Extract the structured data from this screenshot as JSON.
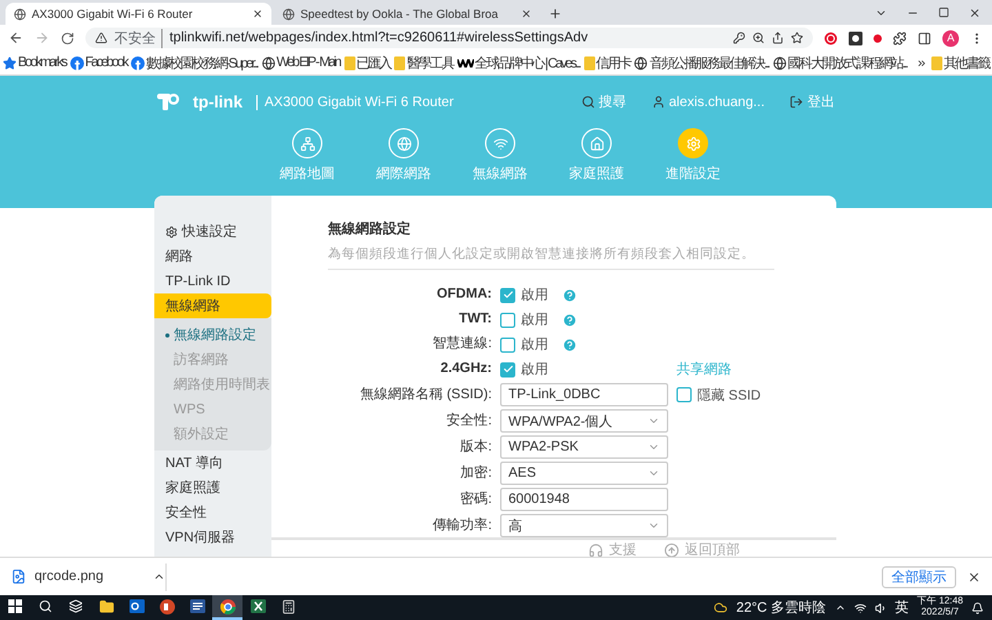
{
  "browser": {
    "tabs": [
      {
        "title": "AX3000 Gigabit Wi-Fi 6 Router",
        "selected": true
      },
      {
        "title": "Speedtest by Ookla - The Global Broa",
        "selected": false
      }
    ],
    "address": {
      "security": "不安全",
      "url": "tplinkwifi.net/webpages/index.html?t=c9260611#wirelessSettingsAdv"
    },
    "profile": "A",
    "bookmarks": [
      {
        "label": "Bookmarks",
        "kind": "star"
      },
      {
        "label": "Facebook",
        "kind": "facebook"
      },
      {
        "label": "數據校園校務網-Super...",
        "kind": "facebook"
      },
      {
        "label": "Web EIP - Main",
        "kind": "globe"
      },
      {
        "label": "已匯入",
        "kind": "folder"
      },
      {
        "label": "醫學工具",
        "kind": "folder"
      },
      {
        "label": "全球品牌中心 | Caves...",
        "kind": "wix"
      },
      {
        "label": "信用卡",
        "kind": "folder"
      },
      {
        "label": "音頻公播服務最佳解決...",
        "kind": "globe"
      },
      {
        "label": "國科大開放式課程網站...",
        "kind": "globe"
      }
    ],
    "other_bookmarks": "其他書籤"
  },
  "header": {
    "brand": "tp-link",
    "model": "AX3000 Gigabit Wi-Fi 6 Router",
    "search": "搜尋",
    "user": "alexis.chuang...",
    "logout": "登出"
  },
  "nav": [
    {
      "label": "網路地圖",
      "selected": false
    },
    {
      "label": "網際網路",
      "selected": false
    },
    {
      "label": "無線網路",
      "selected": false
    },
    {
      "label": "家庭照護",
      "selected": false
    },
    {
      "label": "進階設定",
      "selected": true
    }
  ],
  "sidebar": [
    {
      "label": "快速設定",
      "kind": "quick",
      "selected": false
    },
    {
      "label": "網路",
      "selected": false
    },
    {
      "label": "TP-Link ID",
      "selected": false
    },
    {
      "label": "無線網路",
      "selected": true,
      "children": [
        {
          "label": "無線網路設定",
          "selected": true
        },
        {
          "label": "訪客網路",
          "selected": false
        },
        {
          "label": "網路使用時間表",
          "selected": false
        },
        {
          "label": "WPS",
          "selected": false
        },
        {
          "label": "額外設定",
          "selected": false
        }
      ]
    },
    {
      "label": "NAT 導向",
      "selected": false
    },
    {
      "label": "家庭照護",
      "selected": false
    },
    {
      "label": "安全性",
      "selected": false
    },
    {
      "label": "VPN伺服器",
      "selected": false
    }
  ],
  "content": {
    "title": "無線網路設定",
    "description": "為每個頻段進行個人化設定或開啟智慧連接將所有頻段套入相同設定。",
    "toggles": [
      {
        "label": "OFDMA:",
        "bold": true,
        "checked": true,
        "option": "啟用",
        "help": true
      },
      {
        "label": "TWT:",
        "bold": true,
        "checked": false,
        "option": "啟用",
        "help": true
      },
      {
        "label": "智慧連線:",
        "bold": false,
        "checked": false,
        "option": "啟用",
        "help": true
      },
      {
        "label": "2.4GHz:",
        "bold": true,
        "checked": true,
        "option": "啟用",
        "help": false,
        "link": "共享網路"
      }
    ],
    "fields": [
      {
        "label": "無線網路名稱 (SSID):",
        "kind": "input",
        "value": "TP-Link_0DBC",
        "side": {
          "label": "隱藏 SSID",
          "checked": false
        }
      },
      {
        "label": "安全性:",
        "kind": "select",
        "value": "WPA/WPA2-個人"
      },
      {
        "label": "版本:",
        "kind": "select",
        "value": "WPA2-PSK"
      },
      {
        "label": "加密:",
        "kind": "select",
        "value": "AES"
      },
      {
        "label": "密碼:",
        "kind": "input",
        "value": "60001948"
      },
      {
        "label": "傳輸功率:",
        "kind": "select",
        "value": "高"
      }
    ]
  },
  "footer": {
    "support": "支援",
    "back_to_top": "返回頂部"
  },
  "downloads": {
    "file": "qrcode.png",
    "show_all": "全部顯示"
  },
  "taskbar": {
    "apps": [
      {
        "kind": "start",
        "selected": false
      },
      {
        "kind": "search",
        "selected": false
      },
      {
        "kind": "taskview",
        "selected": false
      },
      {
        "kind": "explorer",
        "selected": false
      },
      {
        "kind": "outlook",
        "selected": false
      },
      {
        "kind": "powerpoint",
        "selected": false
      },
      {
        "kind": "word",
        "selected": false
      },
      {
        "kind": "chrome",
        "selected": true
      },
      {
        "kind": "excel",
        "selected": false
      },
      {
        "kind": "calculator",
        "selected": false
      }
    ],
    "weather": "22°C 多雲時陰",
    "language": "英",
    "time": "下午 12:48",
    "date": "2022/5/7"
  }
}
